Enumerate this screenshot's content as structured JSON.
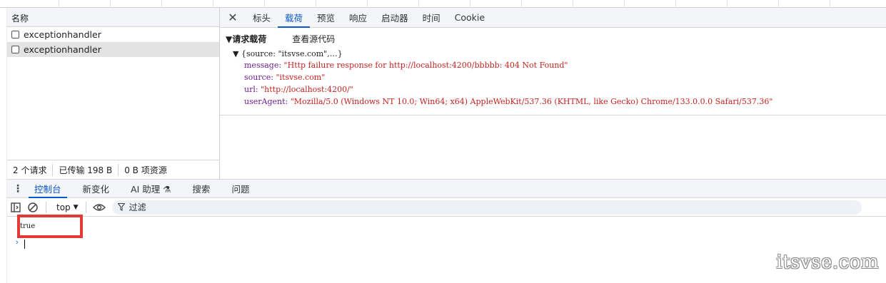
{
  "request_list": {
    "header": "名称",
    "items": [
      {
        "name": "exceptionhandler",
        "selected": false
      },
      {
        "name": "exceptionhandler",
        "selected": true
      }
    ],
    "status": [
      "2 个请求",
      "已传输 198 B",
      "0 B 项资源"
    ]
  },
  "detail": {
    "close_icon": "close-icon",
    "tabs": [
      "标头",
      "载荷",
      "预览",
      "响应",
      "启动器",
      "时间",
      "Cookie"
    ],
    "active_tab": "载荷",
    "payload": {
      "section_title": "▼请求载荷",
      "view_source": "查看源代码",
      "object_summary": "▼ {source: \"itsvse.com\",…}",
      "properties": [
        {
          "key": "message: ",
          "value": "\"Http failure response for http://localhost:4200/bbbbb: 404 Not Found\""
        },
        {
          "key": "source: ",
          "value": "\"itsvse.com\""
        },
        {
          "key": "url: ",
          "value": "\"http://localhost:4200/\""
        },
        {
          "key": "userAgent: ",
          "value": "\"Mozilla/5.0 (Windows NT 10.0; Win64; x64) AppleWebKit/537.36 (KHTML, like Gecko) Chrome/133.0.0.0 Safari/537.36\""
        }
      ]
    }
  },
  "drawer": {
    "tabs": [
      "控制台",
      "新变化",
      "AI 助理 ⚗",
      "搜索",
      "问题"
    ],
    "active_tab": "控制台"
  },
  "console": {
    "context": "top",
    "filter_label": "过滤",
    "log_value": "true",
    "prompt": "›"
  },
  "watermark": "itsvse.com",
  "colors": {
    "accent": "#0b57d0",
    "highlight_box": "#e53935",
    "string_value": "#c5221f",
    "property_key": "#6d1d8f"
  }
}
